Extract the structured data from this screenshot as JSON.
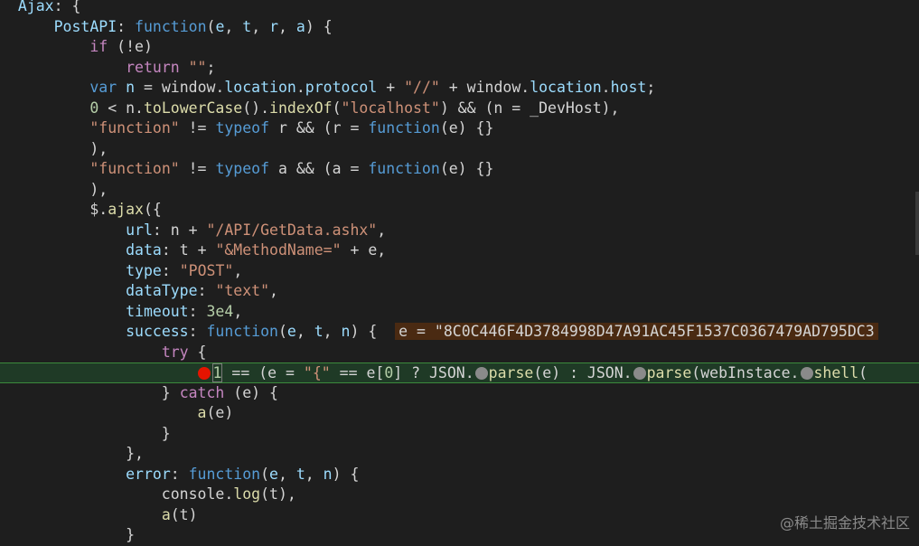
{
  "code_lines": [
    [
      {
        "c": "t-p",
        "t": "  "
      },
      {
        "c": "t-var",
        "t": "Ajax"
      },
      {
        "c": "t-p",
        "t": ": {"
      }
    ],
    [
      {
        "c": "t-p",
        "t": "      "
      },
      {
        "c": "t-var",
        "t": "PostAPI"
      },
      {
        "c": "t-p",
        "t": ": "
      },
      {
        "c": "t-kw",
        "t": "function"
      },
      {
        "c": "t-p",
        "t": "("
      },
      {
        "c": "t-param",
        "t": "e"
      },
      {
        "c": "t-p",
        "t": ", "
      },
      {
        "c": "t-param",
        "t": "t"
      },
      {
        "c": "t-p",
        "t": ", "
      },
      {
        "c": "t-param",
        "t": "r"
      },
      {
        "c": "t-p",
        "t": ", "
      },
      {
        "c": "t-param",
        "t": "a"
      },
      {
        "c": "t-p",
        "t": ") {"
      }
    ],
    [
      {
        "c": "t-p",
        "t": "          "
      },
      {
        "c": "t-kc",
        "t": "if"
      },
      {
        "c": "t-p",
        "t": " (!e)"
      }
    ],
    [
      {
        "c": "t-p",
        "t": "              "
      },
      {
        "c": "t-kc",
        "t": "return"
      },
      {
        "c": "t-p",
        "t": " "
      },
      {
        "c": "t-str",
        "t": "\"\""
      },
      {
        "c": "t-p",
        "t": ";"
      }
    ],
    [
      {
        "c": "t-p",
        "t": "          "
      },
      {
        "c": "t-kw",
        "t": "var"
      },
      {
        "c": "t-p",
        "t": " "
      },
      {
        "c": "t-var",
        "t": "n"
      },
      {
        "c": "t-p",
        "t": " = window."
      },
      {
        "c": "t-var",
        "t": "location"
      },
      {
        "c": "t-p",
        "t": "."
      },
      {
        "c": "t-var",
        "t": "protocol"
      },
      {
        "c": "t-p",
        "t": " + "
      },
      {
        "c": "t-str",
        "t": "\"//\""
      },
      {
        "c": "t-p",
        "t": " + window."
      },
      {
        "c": "t-var",
        "t": "location"
      },
      {
        "c": "t-p",
        "t": "."
      },
      {
        "c": "t-var",
        "t": "host"
      },
      {
        "c": "t-p",
        "t": ";"
      }
    ],
    [
      {
        "c": "t-p",
        "t": "          "
      },
      {
        "c": "t-num",
        "t": "0"
      },
      {
        "c": "t-p",
        "t": " < n."
      },
      {
        "c": "t-fn",
        "t": "toLowerCase"
      },
      {
        "c": "t-p",
        "t": "()."
      },
      {
        "c": "t-fn",
        "t": "indexOf"
      },
      {
        "c": "t-p",
        "t": "("
      },
      {
        "c": "t-str",
        "t": "\"localhost\""
      },
      {
        "c": "t-p",
        "t": ") && (n = _DevHost),"
      }
    ],
    [
      {
        "c": "t-p",
        "t": "          "
      },
      {
        "c": "t-str",
        "t": "\"function\""
      },
      {
        "c": "t-p",
        "t": " != "
      },
      {
        "c": "t-kw",
        "t": "typeof"
      },
      {
        "c": "t-p",
        "t": " r && (r = "
      },
      {
        "c": "t-kw",
        "t": "function"
      },
      {
        "c": "t-p",
        "t": "(e) {}"
      }
    ],
    [
      {
        "c": "t-p",
        "t": "          ),"
      }
    ],
    [
      {
        "c": "t-p",
        "t": "          "
      },
      {
        "c": "t-str",
        "t": "\"function\""
      },
      {
        "c": "t-p",
        "t": " != "
      },
      {
        "c": "t-kw",
        "t": "typeof"
      },
      {
        "c": "t-p",
        "t": " a && (a = "
      },
      {
        "c": "t-kw",
        "t": "function"
      },
      {
        "c": "t-p",
        "t": "(e) {}"
      }
    ],
    [
      {
        "c": "t-p",
        "t": "          ),"
      }
    ],
    [
      {
        "c": "t-p",
        "t": "          $."
      },
      {
        "c": "t-fn",
        "t": "ajax"
      },
      {
        "c": "t-p",
        "t": "({"
      }
    ],
    [
      {
        "c": "t-p",
        "t": "              "
      },
      {
        "c": "t-var",
        "t": "url"
      },
      {
        "c": "t-p",
        "t": ": n + "
      },
      {
        "c": "t-str",
        "t": "\"/API/GetData.ashx\""
      },
      {
        "c": "t-p",
        "t": ","
      }
    ],
    [
      {
        "c": "t-p",
        "t": "              "
      },
      {
        "c": "t-var",
        "t": "data"
      },
      {
        "c": "t-p",
        "t": ": t + "
      },
      {
        "c": "t-str",
        "t": "\"&MethodName=\""
      },
      {
        "c": "t-p",
        "t": " + e,"
      }
    ],
    [
      {
        "c": "t-p",
        "t": "              "
      },
      {
        "c": "t-var",
        "t": "type"
      },
      {
        "c": "t-p",
        "t": ": "
      },
      {
        "c": "t-str",
        "t": "\"POST\""
      },
      {
        "c": "t-p",
        "t": ","
      }
    ],
    [
      {
        "c": "t-p",
        "t": "              "
      },
      {
        "c": "t-var",
        "t": "dataType"
      },
      {
        "c": "t-p",
        "t": ": "
      },
      {
        "c": "t-str",
        "t": "\"text\""
      },
      {
        "c": "t-p",
        "t": ","
      }
    ],
    [
      {
        "c": "t-p",
        "t": "              "
      },
      {
        "c": "t-var",
        "t": "timeout"
      },
      {
        "c": "t-p",
        "t": ": "
      },
      {
        "c": "t-num",
        "t": "3e4"
      },
      {
        "c": "t-p",
        "t": ","
      }
    ],
    [
      {
        "c": "t-p",
        "t": "              "
      },
      {
        "c": "t-var",
        "t": "success"
      },
      {
        "c": "t-p",
        "t": ": "
      },
      {
        "c": "t-kw",
        "t": "function"
      },
      {
        "c": "t-p",
        "t": "("
      },
      {
        "c": "t-param",
        "t": "e"
      },
      {
        "c": "t-p",
        "t": ", "
      },
      {
        "c": "t-param",
        "t": "t"
      },
      {
        "c": "t-p",
        "t": ", "
      },
      {
        "c": "t-param",
        "t": "n"
      },
      {
        "c": "t-p",
        "t": ") {  "
      },
      {
        "c": "inline-value",
        "t": "e = \"8C0C446F4D3784998D47A91AC45F1537C0367479AD795DC3"
      }
    ],
    [
      {
        "c": "t-p",
        "t": "                  "
      },
      {
        "c": "t-kc",
        "t": "try"
      },
      {
        "c": "t-p",
        "t": " {"
      }
    ],
    [
      {
        "c": "t-p",
        "t": "                      "
      },
      {
        "c": "BP",
        "t": ""
      },
      {
        "c": "cursor-num",
        "t": "1"
      },
      {
        "c": "t-p",
        "t": " == (e = "
      },
      {
        "c": "t-str",
        "t": "\"{\""
      },
      {
        "c": "t-p",
        "t": " == e["
      },
      {
        "c": "t-num",
        "t": "0"
      },
      {
        "c": "t-p",
        "t": "] ? JSON."
      },
      {
        "c": "IM",
        "t": ""
      },
      {
        "c": "t-fn",
        "t": "parse"
      },
      {
        "c": "t-p",
        "t": "(e) : JSON."
      },
      {
        "c": "IM",
        "t": ""
      },
      {
        "c": "t-fn",
        "t": "parse"
      },
      {
        "c": "t-p",
        "t": "(webInstace."
      },
      {
        "c": "IM",
        "t": ""
      },
      {
        "c": "t-fn",
        "t": "shell"
      },
      {
        "c": "t-p",
        "t": "("
      }
    ],
    [
      {
        "c": "t-p",
        "t": "                  } "
      },
      {
        "c": "t-kc",
        "t": "catch"
      },
      {
        "c": "t-p",
        "t": " (e) {"
      }
    ],
    [
      {
        "c": "t-p",
        "t": "                      "
      },
      {
        "c": "t-fn",
        "t": "a"
      },
      {
        "c": "t-p",
        "t": "(e)"
      }
    ],
    [
      {
        "c": "t-p",
        "t": "                  }"
      }
    ],
    [
      {
        "c": "t-p",
        "t": "              },"
      }
    ],
    [
      {
        "c": "t-p",
        "t": "              "
      },
      {
        "c": "t-var",
        "t": "error"
      },
      {
        "c": "t-p",
        "t": ": "
      },
      {
        "c": "t-kw",
        "t": "function"
      },
      {
        "c": "t-p",
        "t": "("
      },
      {
        "c": "t-param",
        "t": "e"
      },
      {
        "c": "t-p",
        "t": ", "
      },
      {
        "c": "t-param",
        "t": "t"
      },
      {
        "c": "t-p",
        "t": ", "
      },
      {
        "c": "t-param",
        "t": "n"
      },
      {
        "c": "t-p",
        "t": ") {"
      }
    ],
    [
      {
        "c": "t-p",
        "t": "                  console."
      },
      {
        "c": "t-fn",
        "t": "log"
      },
      {
        "c": "t-p",
        "t": "(t),"
      }
    ],
    [
      {
        "c": "t-p",
        "t": "                  "
      },
      {
        "c": "t-fn",
        "t": "a"
      },
      {
        "c": "t-p",
        "t": "(t)"
      }
    ],
    [
      {
        "c": "t-p",
        "t": "              }"
      }
    ]
  ],
  "paused_line_index": 18,
  "watermark": "@稀土掘金技术社区",
  "colors": {
    "background": "#1e1e1e",
    "paused_line_bg": "#1f3a26",
    "breakpoint": "#e51400",
    "inline_value_bg": "#4a2a12"
  }
}
